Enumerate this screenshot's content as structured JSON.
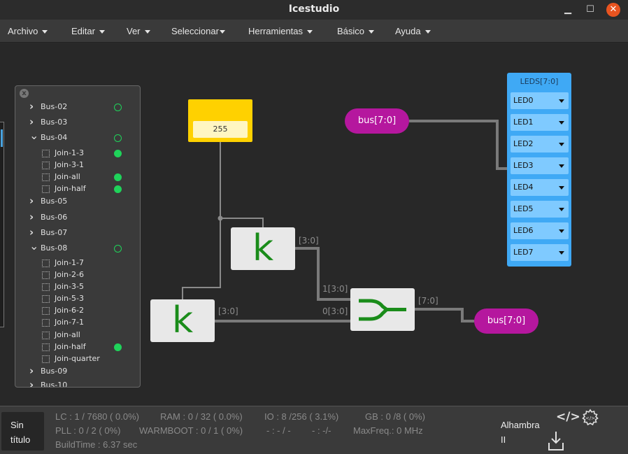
{
  "window": {
    "title": "Icestudio",
    "min": "▁",
    "max": "☐",
    "close": "✕"
  },
  "menu": [
    {
      "label": "Archivo"
    },
    {
      "label": "Editar"
    },
    {
      "label": "Ver"
    },
    {
      "label": "Seleccionar"
    },
    {
      "label": "Herramientas"
    },
    {
      "label": "Básico"
    },
    {
      "label": "Ayuda"
    }
  ],
  "collections": {
    "close_icon": "x",
    "items": [
      {
        "label": "Bus-02",
        "type": "folder",
        "expanded": false,
        "status": "ring"
      },
      {
        "label": "Bus-03",
        "type": "folder",
        "expanded": false,
        "status": ""
      },
      {
        "label": "Bus-04",
        "type": "folder",
        "expanded": true,
        "status": "ring"
      },
      {
        "label": "Join-1-3",
        "type": "file",
        "status": "dot"
      },
      {
        "label": "Join-3-1",
        "type": "file",
        "status": ""
      },
      {
        "label": "Join-all",
        "type": "file",
        "status": "dot"
      },
      {
        "label": "Join-half",
        "type": "file",
        "status": "dot"
      },
      {
        "label": "Bus-05",
        "type": "folder",
        "expanded": false,
        "status": ""
      },
      {
        "label": "Bus-06",
        "type": "folder",
        "expanded": false,
        "status": ""
      },
      {
        "label": "Bus-07",
        "type": "folder",
        "expanded": false,
        "status": ""
      },
      {
        "label": "Bus-08",
        "type": "folder",
        "expanded": true,
        "status": "ring"
      },
      {
        "label": "Join-1-7",
        "type": "file",
        "status": ""
      },
      {
        "label": "Join-2-6",
        "type": "file",
        "status": ""
      },
      {
        "label": "Join-3-5",
        "type": "file",
        "status": ""
      },
      {
        "label": "Join-5-3",
        "type": "file",
        "status": ""
      },
      {
        "label": "Join-6-2",
        "type": "file",
        "status": ""
      },
      {
        "label": "Join-7-1",
        "type": "file",
        "status": ""
      },
      {
        "label": "Join-all",
        "type": "file",
        "status": ""
      },
      {
        "label": "Join-half",
        "type": "file",
        "status": "dot"
      },
      {
        "label": "Join-quarter",
        "type": "file",
        "status": ""
      },
      {
        "label": "Bus-09",
        "type": "folder",
        "expanded": false,
        "status": ""
      },
      {
        "label": "Bus-10",
        "type": "folder",
        "expanded": false,
        "status": ""
      }
    ]
  },
  "circuit": {
    "constant_value": "255",
    "k_label": "k",
    "bus_in_label": "bus[7:0]",
    "bus_out_label": "bus[7:0]",
    "wire_k1_label": "[3:0]",
    "wire_k2_label": "[3:0]",
    "join_in1_label": "1[3:0]",
    "join_in0_label": "0[3:0]",
    "join_out_label": "[7:0]",
    "leds": {
      "title": "LEDS[7:0]",
      "pins": [
        "LED0",
        "LED1",
        "LED2",
        "LED3",
        "LED4",
        "LED5",
        "LED6",
        "LED7"
      ]
    }
  },
  "footer": {
    "file_name_line1": "Sin",
    "file_name_line2": "título",
    "lc": "LC : 1 / 7680 ( 0.0%)",
    "ram": "RAM : 0 / 32 ( 0.0%)",
    "io": "IO :  8 /256  ( 3.1%)",
    "gb": "GB :  0 /8  ( 0%)",
    "pll": "PLL : 0 / 2 ( 0%)",
    "warmboot": "WARMBOOT : 0 / 1 ( 0%)",
    "misc1": "- : - / -",
    "misc2": "- :  -/-",
    "maxfreq": "MaxFreq.:    0 MHz",
    "buildtime": "BuildTime :    6.37 sec",
    "board_line1": "Alhambra",
    "board_line2": "II",
    "code_icon": "</>",
    "settings_icon": "gear",
    "upload_icon": "download-tray"
  },
  "colors": {
    "constant": "#ffd100",
    "bus_pill": "#b5179e",
    "leds_block": "#3fa9f5",
    "status_green": "#1fd35a",
    "k_green": "#1a8c1a"
  }
}
